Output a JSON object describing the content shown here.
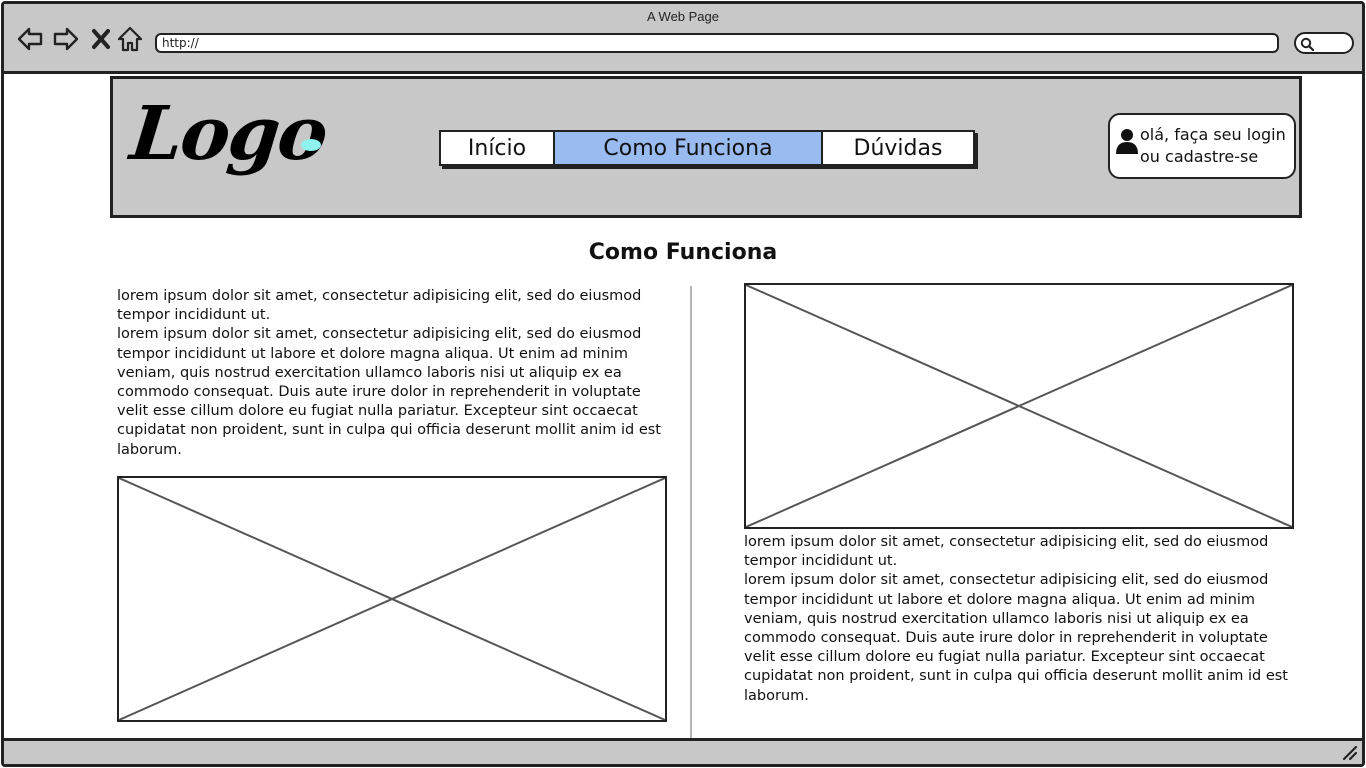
{
  "window": {
    "title": "A Web Page",
    "address": "http://"
  },
  "icons": {
    "back": "arrow-left-icon",
    "forward": "arrow-right-icon",
    "stop": "close-icon",
    "home": "home-icon",
    "search": "search-icon",
    "user": "user-icon",
    "resize": "resize-grip-icon"
  },
  "header": {
    "logo_text": "Logo",
    "menu": [
      {
        "label": "Início"
      },
      {
        "label": "Como Funciona"
      },
      {
        "label": "Dúvidas"
      }
    ],
    "login": {
      "text": "olá, faça seu login ou cadastre-se"
    }
  },
  "main": {
    "title": "Como Funciona",
    "left": {
      "p1": "lorem ipsum dolor sit amet, consectetur adipisicing elit, sed do eiusmod tempor incididunt ut.",
      "p2": "lorem ipsum dolor sit amet, consectetur adipisicing elit, sed do eiusmod tempor incididunt ut labore et dolore magna aliqua. Ut enim ad minim veniam, quis nostrud exercitation ullamco laboris nisi ut aliquip ex ea commodo consequat. Duis aute irure dolor in reprehenderit in voluptate velit esse cillum dolore eu fugiat nulla pariatur. Excepteur sint occaecat cupidatat non proident, sunt in culpa qui officia deserunt mollit anim id est laborum."
    },
    "right": {
      "p1": "lorem ipsum dolor sit amet, consectetur adipisicing elit, sed do eiusmod tempor incididunt ut.",
      "p2": "lorem ipsum dolor sit amet, consectetur adipisicing elit, sed do eiusmod tempor incididunt ut labore et dolore magna aliqua. Ut enim ad minim veniam, quis nostrud exercitation ullamco laboris nisi ut aliquip ex ea commodo consequat. Duis aute irure dolor in reprehenderit in voluptate velit esse cillum dolore eu fugiat nulla pariatur. Excepteur sint occaecat cupidatat non proident, sunt in culpa qui officia deserunt mollit anim id est laborum."
    }
  },
  "colors": {
    "chrome": "#c8c8c8",
    "active_menu": "#99bbef",
    "logo_accent": "#8ff3f0",
    "border": "#222222"
  }
}
